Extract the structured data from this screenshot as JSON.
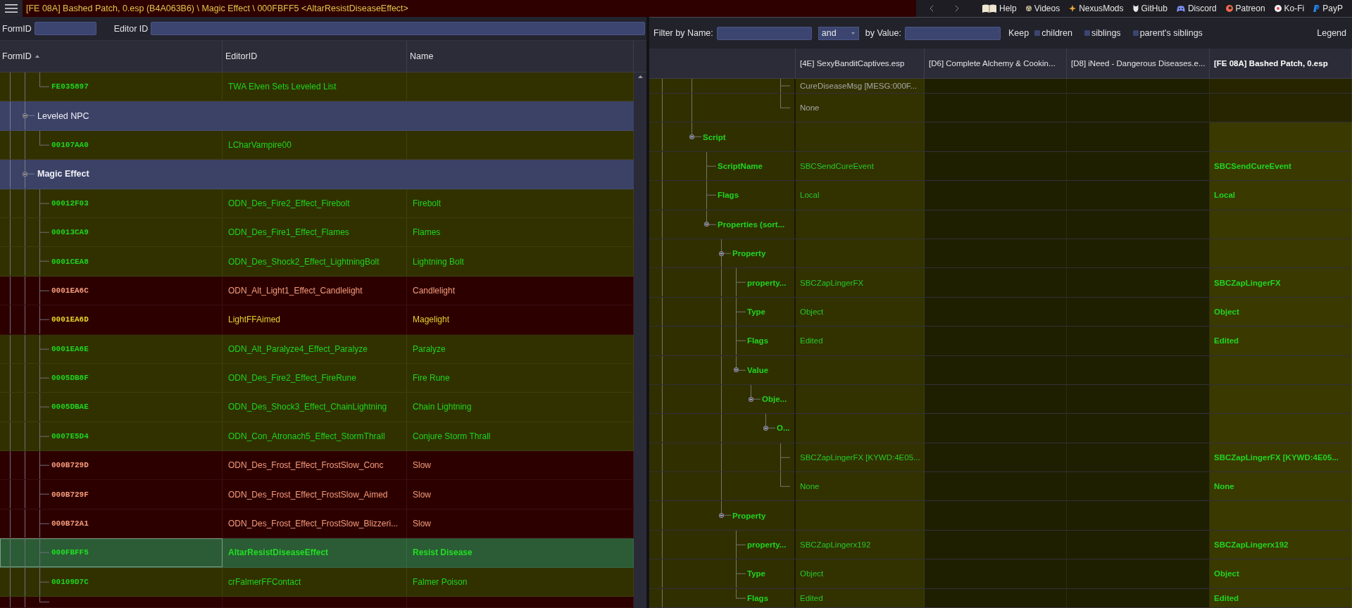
{
  "top_bar": {
    "title": "[FE 08A] Bashed Patch, 0.esp (B4A063B6) \\ Magic Effect \\ 000FBFF5 <AltarResistDiseaseEffect>",
    "links": [
      {
        "kind": "book",
        "label": "Help"
      },
      {
        "kind": "reel",
        "label": "Videos"
      },
      {
        "kind": "star",
        "label": "NexusMods"
      },
      {
        "kind": "cat",
        "label": "GitHub"
      },
      {
        "kind": "gamepad",
        "label": "Discord"
      },
      {
        "kind": "ring",
        "label": "Patreon"
      },
      {
        "kind": "dot",
        "label": "Ko-Fi"
      },
      {
        "kind": "slant",
        "label": "PayP"
      }
    ]
  },
  "record_list": {
    "filter": {
      "form_id_label": "FormID",
      "editor_id_label": "Editor ID"
    },
    "columns": [
      {
        "label": "FormID",
        "sorted": true
      },
      {
        "label": "EditorID",
        "sorted": false
      },
      {
        "label": "Name",
        "sorted": false
      }
    ],
    "tree": [
      {
        "kind": "group",
        "children": [
          {
            "kind": "record",
            "form_id": "FE035897",
            "editor_id": "TWA Elven Sets Leveled List",
            "conflict": false,
            "color": "#1fd41f",
            "selected": false
          }
        ]
      },
      {
        "kind": "group",
        "label": "Leveled NPC",
        "expanded": true,
        "emphasized": false,
        "children": [
          {
            "kind": "record",
            "form_id": "00107AA0",
            "editor_id": "LCharVampire00",
            "conflict": false,
            "color": "#1fd41f",
            "selected": false
          }
        ]
      },
      {
        "kind": "group",
        "label": "Magic Effect",
        "expanded": true,
        "emphasized": true,
        "children": [
          {
            "kind": "record",
            "form_id": "00012F03",
            "editor_id": "ODN_Des_Fire2_Effect_Firebolt",
            "name": "Firebolt",
            "conflict": false,
            "color": "#1fd41f",
            "selected": false
          },
          {
            "kind": "record",
            "form_id": "00013CA9",
            "editor_id": "ODN_Des_Fire1_Effect_Flames",
            "name": "Flames",
            "conflict": false,
            "color": "#1fd41f",
            "selected": false
          },
          {
            "kind": "record",
            "form_id": "0001CEA8",
            "editor_id": "ODN_Des_Shock2_Effect_LightningBolt",
            "name": "Lightning Bolt",
            "conflict": false,
            "color": "#1fd41f",
            "selected": false
          },
          {
            "kind": "record",
            "form_id": "0001EA6C",
            "editor_id": "ODN_Alt_Light1_Effect_Candlelight",
            "name": "Candlelight",
            "conflict": true,
            "color": "#f59c7c",
            "selected": false
          },
          {
            "kind": "record",
            "form_id": "0001EA6D",
            "editor_id": "LightFFAimed",
            "name": "Magelight",
            "conflict": true,
            "color": "#e7d22c",
            "selected": false
          },
          {
            "kind": "record",
            "form_id": "0001EA6E",
            "editor_id": "ODN_Alt_Paralyze4_Effect_Paralyze",
            "name": "Paralyze",
            "conflict": false,
            "color": "#1fd41f",
            "selected": false
          },
          {
            "kind": "record",
            "form_id": "0005DB8F",
            "editor_id": "ODN_Des_Fire2_Effect_FireRune",
            "name": "Fire Rune",
            "conflict": false,
            "color": "#1fd41f",
            "selected": false
          },
          {
            "kind": "record",
            "form_id": "0005DBAE",
            "editor_id": "ODN_Des_Shock3_Effect_ChainLightning",
            "name": "Chain Lightning",
            "conflict": false,
            "color": "#1fd41f",
            "selected": false
          },
          {
            "kind": "record",
            "form_id": "0007E5D4",
            "editor_id": "ODN_Con_Atronach5_Effect_StormThrall",
            "name": "Conjure Storm Thrall",
            "conflict": false,
            "color": "#1fd41f",
            "selected": false
          },
          {
            "kind": "record",
            "form_id": "000B729D",
            "editor_id": "ODN_Des_Frost_Effect_FrostSlow_Conc",
            "name": "Slow",
            "conflict": true,
            "color": "#f59c7c",
            "selected": false
          },
          {
            "kind": "record",
            "form_id": "000B729F",
            "editor_id": "ODN_Des_Frost_Effect_FrostSlow_Aimed",
            "name": "Slow",
            "conflict": true,
            "color": "#f59c7c",
            "selected": false
          },
          {
            "kind": "record",
            "form_id": "000B72A1",
            "editor_id": "ODN_Des_Frost_Effect_FrostSlow_Blizzeri...",
            "name": "Slow",
            "conflict": true,
            "color": "#f59c7c",
            "selected": false
          },
          {
            "kind": "record",
            "form_id": "000FBFF5",
            "editor_id": "AltarResistDiseaseEffect",
            "name": "Resist Disease",
            "color": "#22dd22",
            "selected": true
          },
          {
            "kind": "record",
            "form_id": "00109D7C",
            "editor_id": "crFalmerFFContact",
            "name": "Falmer Poison",
            "conflict": false,
            "color": "#1fd41f",
            "selected": false
          },
          {
            "kind": "record",
            "conflict": true,
            "selected": false
          }
        ]
      }
    ]
  },
  "compare_view": {
    "filter": {
      "name_label": "Filter by Name:",
      "operator": "and",
      "value_label": "by Value:",
      "keep_label": "Keep",
      "keep_options": [
        {
          "label": "children",
          "checked": false
        },
        {
          "label": "siblings",
          "checked": false
        },
        {
          "label": "parent's siblings",
          "checked": false
        }
      ],
      "legend": "Legend"
    },
    "columns": [
      {
        "label": "[4E] SexyBanditCaptives.esp",
        "winner": false
      },
      {
        "label": "[D6] Complete Alchemy & Cookin...",
        "winner": false
      },
      {
        "label": "[D8] iNeed - Dangerous Diseases.e...",
        "winner": false
      },
      {
        "label": "[FE 08A] Bashed Patch, 0.esp",
        "winner": true
      }
    ],
    "tree": [
      {
        "children": [
          {
            "children": [
              {
                "children": [
                  {
                    "children": [
                      {
                        "children": [
                          {
                            "children": [
                              {
                                "children": [
                                  {
                                    "children": [
                                      {
                                        "cells": [
                                          {
                                            "present": true,
                                            "text": "CureDiseaseMsg [MESG:000F...",
                                            "greyed": true
                                          },
                                          {
                                            "present": false
                                          },
                                          {
                                            "present": false
                                          },
                                          {
                                            "present": false
                                          }
                                        ]
                                      },
                                      {
                                        "cells": [
                                          {
                                            "present": true,
                                            "text": "None",
                                            "greyed": true
                                          },
                                          {
                                            "present": false
                                          },
                                          {
                                            "present": false
                                          },
                                          {
                                            "present": false
                                          }
                                        ]
                                      }
                                    ]
                                  }
                                ]
                              }
                            ]
                          }
                        ]
                      }
                    ]
                  }
                ]
              },
              {
                "label": "Script",
                "expanded": true,
                "cells": [
                  {
                    "present": true
                  },
                  {
                    "present": false
                  },
                  {
                    "present": false
                  },
                  {
                    "present": true
                  }
                ],
                "children": [
                  {
                    "label": "ScriptName",
                    "cells": [
                      {
                        "present": true,
                        "text": "SBCSendCureEvent",
                        "greyed": false
                      },
                      {
                        "present": false
                      },
                      {
                        "present": false
                      },
                      {
                        "present": true,
                        "text": "SBCSendCureEvent",
                        "greyed": false
                      }
                    ]
                  },
                  {
                    "label": "Flags",
                    "cells": [
                      {
                        "present": true,
                        "text": "Local",
                        "greyed": false
                      },
                      {
                        "present": false
                      },
                      {
                        "present": false
                      },
                      {
                        "present": true,
                        "text": "Local",
                        "greyed": false
                      }
                    ]
                  },
                  {
                    "label": "Properties (sort...",
                    "expanded": true,
                    "cells": [
                      {
                        "present": true
                      },
                      {
                        "present": false
                      },
                      {
                        "present": false
                      },
                      {
                        "present": true
                      }
                    ],
                    "children": [
                      {
                        "label": "Property",
                        "expanded": true,
                        "cells": [
                          {
                            "present": true
                          },
                          {
                            "present": false
                          },
                          {
                            "present": false
                          },
                          {
                            "present": true
                          }
                        ],
                        "children": [
                          {
                            "label": "property...",
                            "cells": [
                              {
                                "present": true,
                                "text": "SBCZapLingerFX",
                                "greyed": false
                              },
                              {
                                "present": false
                              },
                              {
                                "present": false
                              },
                              {
                                "present": true,
                                "text": "SBCZapLingerFX",
                                "greyed": false
                              }
                            ]
                          },
                          {
                            "label": "Type",
                            "cells": [
                              {
                                "present": true,
                                "text": "Object",
                                "greyed": false
                              },
                              {
                                "present": false
                              },
                              {
                                "present": false
                              },
                              {
                                "present": true,
                                "text": "Object",
                                "greyed": false
                              }
                            ]
                          },
                          {
                            "label": "Flags",
                            "cells": [
                              {
                                "present": true,
                                "text": "Edited",
                                "greyed": false
                              },
                              {
                                "present": false
                              },
                              {
                                "present": false
                              },
                              {
                                "present": true,
                                "text": "Edited",
                                "greyed": false
                              }
                            ]
                          },
                          {
                            "label": "Value",
                            "expanded": true,
                            "cells": [
                              {
                                "present": true
                              },
                              {
                                "present": false
                              },
                              {
                                "present": false
                              },
                              {
                                "present": true
                              }
                            ],
                            "children": [
                              {
                                "label": "Obje...",
                                "expanded": true,
                                "cells": [
                                  {
                                    "present": true
                                  },
                                  {
                                    "present": false
                                  },
                                  {
                                    "present": false
                                  },
                                  {
                                    "present": true
                                  }
                                ],
                                "children": [
                                  {
                                    "label": "O...",
                                    "expanded": true,
                                    "cells": [
                                      {
                                        "present": true
                                      },
                                      {
                                        "present": false
                                      },
                                      {
                                        "present": false
                                      },
                                      {
                                        "present": true
                                      }
                                    ],
                                    "children": [
                                      {
                                        "cells": [
                                          {
                                            "present": true,
                                            "text": "SBCZapLingerFX [KYWD:4E05...",
                                            "greyed": false
                                          },
                                          {
                                            "present": false
                                          },
                                          {
                                            "present": false
                                          },
                                          {
                                            "present": true,
                                            "text": "SBCZapLingerFX [KYWD:4E05...",
                                            "greyed": false
                                          }
                                        ]
                                      },
                                      {
                                        "cells": [
                                          {
                                            "present": true,
                                            "text": "None",
                                            "greyed": false
                                          },
                                          {
                                            "present": false
                                          },
                                          {
                                            "present": false
                                          },
                                          {
                                            "present": true,
                                            "text": "None",
                                            "greyed": false
                                          }
                                        ]
                                      }
                                    ]
                                  }
                                ]
                              }
                            ]
                          }
                        ]
                      },
                      {
                        "label": "Property",
                        "expanded": true,
                        "cells": [
                          {
                            "present": true
                          },
                          {
                            "present": false
                          },
                          {
                            "present": false
                          },
                          {
                            "present": true
                          }
                        ],
                        "children": [
                          {
                            "label": "property...",
                            "cells": [
                              {
                                "present": true,
                                "text": "SBCZapLingerx192",
                                "greyed": false
                              },
                              {
                                "present": false
                              },
                              {
                                "present": false
                              },
                              {
                                "present": true,
                                "text": "SBCZapLingerx192",
                                "greyed": false
                              }
                            ]
                          },
                          {
                            "label": "Type",
                            "cells": [
                              {
                                "present": true,
                                "text": "Object",
                                "greyed": false
                              },
                              {
                                "present": false
                              },
                              {
                                "present": false
                              },
                              {
                                "present": true,
                                "text": "Object",
                                "greyed": false
                              }
                            ]
                          },
                          {
                            "label": "Flags",
                            "cells": [
                              {
                                "present": true,
                                "text": "Edited",
                                "greyed": false
                              },
                              {
                                "present": false
                              },
                              {
                                "present": false
                              },
                              {
                                "present": true,
                                "text": "Edited",
                                "greyed": false
                              }
                            ]
                          }
                        ]
                      }
                    ]
                  }
                ]
              }
            ]
          }
        ]
      }
    ]
  }
}
